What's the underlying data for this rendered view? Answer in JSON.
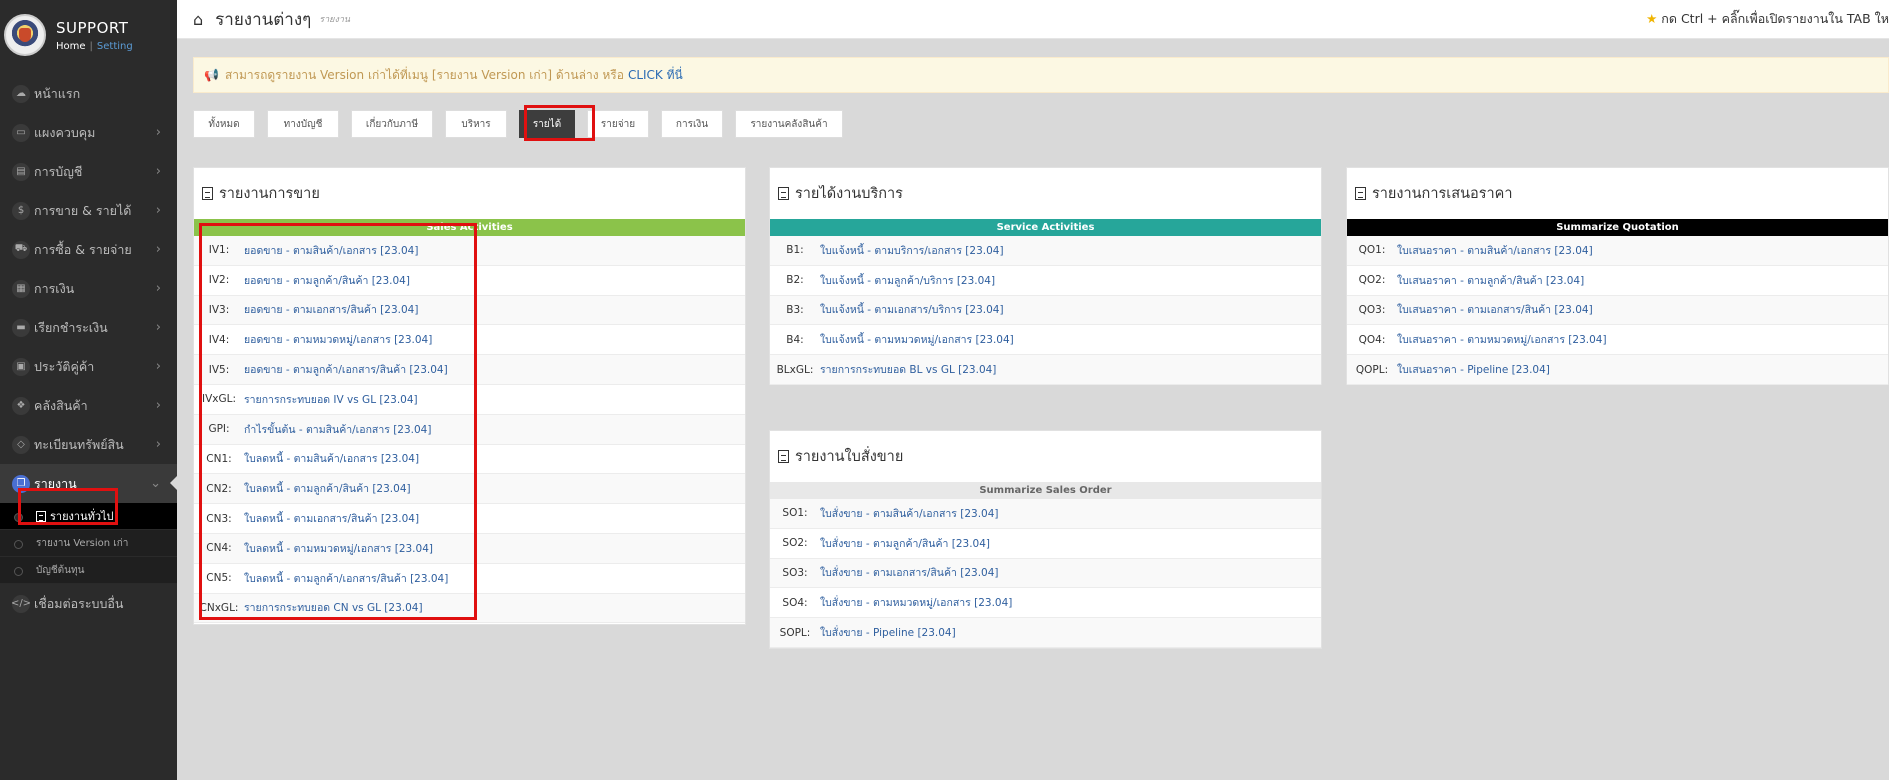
{
  "sidebar": {
    "brand_title": "SUPPORT",
    "home_link": "Home",
    "link_separator": "|",
    "setting_link": "Setting",
    "items": [
      {
        "label": "หน้าแรก",
        "icon": "cloud-icon"
      },
      {
        "label": "แผงควบคุม",
        "icon": "monitor-icon"
      },
      {
        "label": "การบัญชี",
        "icon": "book-icon"
      },
      {
        "label": "การขาย & รายได้",
        "icon": "dollar-icon"
      },
      {
        "label": "การซื้อ & รายจ่าย",
        "icon": "cart-icon"
      },
      {
        "label": "การเงิน",
        "icon": "calendar-icon"
      },
      {
        "label": "เรียกชำระเงิน",
        "icon": "credit-card-icon"
      },
      {
        "label": "ประวัติคู่ค้า",
        "icon": "contact-icon"
      },
      {
        "label": "คลังสินค้า",
        "icon": "cubes-icon"
      },
      {
        "label": "ทะเบียนทรัพย์สิน",
        "icon": "diamond-icon"
      },
      {
        "label": "รายงาน",
        "icon": "copy-icon"
      },
      {
        "label": "เชื่อมต่อระบบอื่น",
        "icon": "code-icon"
      }
    ],
    "report_sub": [
      "รายงานทั่วไป",
      "รายงาน Version เก่า",
      "บัญชีต้นทุน"
    ]
  },
  "topbar": {
    "title": "รายงานต่างๆ",
    "subtitle": "รายงาน",
    "hint": "กด Ctrl + คลิ๊กเพื่อเปิดรายงานใน TAB ให"
  },
  "alert": {
    "text": "สามารถดูรายงาน Version เก่าได้ที่เมนู [รายงาน Version เก่า] ด้านล่าง หรือ",
    "link": "CLICK ที่นี่"
  },
  "tabs": [
    "ทั้งหมด",
    "ทางบัญชี",
    "เกี่ยวกับภาษี",
    "บริหาร",
    "รายได้",
    "รายจ่าย",
    "การเงิน",
    "รายงานคลังสินค้า"
  ],
  "cards": {
    "sales": {
      "title": "รายงานการขาย",
      "band": "Sales Activities",
      "rows": [
        {
          "code": "IV1:",
          "label": "ยอดขาย - ตามสินค้า/เอกสาร [23.04]"
        },
        {
          "code": "IV2:",
          "label": "ยอดขาย - ตามลูกค้า/สินค้า [23.04]"
        },
        {
          "code": "IV3:",
          "label": "ยอดขาย - ตามเอกสาร/สินค้า [23.04]"
        },
        {
          "code": "IV4:",
          "label": "ยอดขาย - ตามหมวดหมู่/เอกสาร [23.04]"
        },
        {
          "code": "IV5:",
          "label": "ยอดขาย - ตามลูกค้า/เอกสาร/สินค้า [23.04]"
        },
        {
          "code": "IVxGL:",
          "label": "รายการกระทบยอด IV vs GL [23.04]"
        },
        {
          "code": "GPI:",
          "label": "กำไรขั้นต้น - ตามสินค้า/เอกสาร [23.04]"
        },
        {
          "code": "CN1:",
          "label": "ใบลดหนี้ - ตามสินค้า/เอกสาร [23.04]"
        },
        {
          "code": "CN2:",
          "label": "ใบลดหนี้ - ตามลูกค้า/สินค้า [23.04]"
        },
        {
          "code": "CN3:",
          "label": "ใบลดหนี้ - ตามเอกสาร/สินค้า [23.04]"
        },
        {
          "code": "CN4:",
          "label": "ใบลดหนี้ - ตามหมวดหมู่/เอกสาร [23.04]"
        },
        {
          "code": "CN5:",
          "label": "ใบลดหนี้ - ตามลูกค้า/เอกสาร/สินค้า [23.04]"
        },
        {
          "code": "CNxGL:",
          "label": "รายการกระทบยอด CN vs GL [23.04]"
        }
      ]
    },
    "service": {
      "title": "รายได้งานบริการ",
      "band": "Service Activities",
      "rows": [
        {
          "code": "B1:",
          "label": "ใบแจ้งหนี้ - ตามบริการ/เอกสาร [23.04]"
        },
        {
          "code": "B2:",
          "label": "ใบแจ้งหนี้ - ตามลูกค้า/บริการ [23.04]"
        },
        {
          "code": "B3:",
          "label": "ใบแจ้งหนี้ - ตามเอกสาร/บริการ [23.04]"
        },
        {
          "code": "B4:",
          "label": "ใบแจ้งหนี้ - ตามหมวดหมู่/เอกสาร [23.04]"
        },
        {
          "code": "BLxGL:",
          "label": "รายการกระทบยอด BL vs GL [23.04]"
        }
      ]
    },
    "quotation": {
      "title": "รายงานการเสนอราคา",
      "band": "Summarize Quotation",
      "rows": [
        {
          "code": "QO1:",
          "label": "ใบเสนอราคา - ตามสินค้า/เอกสาร [23.04]"
        },
        {
          "code": "QO2:",
          "label": "ใบเสนอราคา - ตามลูกค้า/สินค้า [23.04]"
        },
        {
          "code": "QO3:",
          "label": "ใบเสนอราคา - ตามเอกสาร/สินค้า [23.04]"
        },
        {
          "code": "QO4:",
          "label": "ใบเสนอราคา - ตามหมวดหมู่/เอกสาร [23.04]"
        },
        {
          "code": "QOPL:",
          "label": "ใบเสนอราคา - Pipeline [23.04]"
        }
      ]
    },
    "sales_order": {
      "title": "รายงานใบสั่งขาย",
      "band": "Summarize Sales Order",
      "rows": [
        {
          "code": "SO1:",
          "label": "ใบสั่งขาย - ตามสินค้า/เอกสาร [23.04]"
        },
        {
          "code": "SO2:",
          "label": "ใบสั่งขาย - ตามลูกค้า/สินค้า [23.04]"
        },
        {
          "code": "SO3:",
          "label": "ใบสั่งขาย - ตามเอกสาร/สินค้า [23.04]"
        },
        {
          "code": "SO4:",
          "label": "ใบสั่งขาย - ตามหมวดหมู่/เอกสาร [23.04]"
        },
        {
          "code": "SOPL:",
          "label": "ใบสั่งขาย - Pipeline [23.04]"
        }
      ]
    }
  },
  "colors": {
    "sales_band": "#8bc34a",
    "service_band": "#26a69a",
    "quotation_band": "#000000",
    "sales_order_band": "#e8e8e8",
    "highlight": "#e01010"
  }
}
